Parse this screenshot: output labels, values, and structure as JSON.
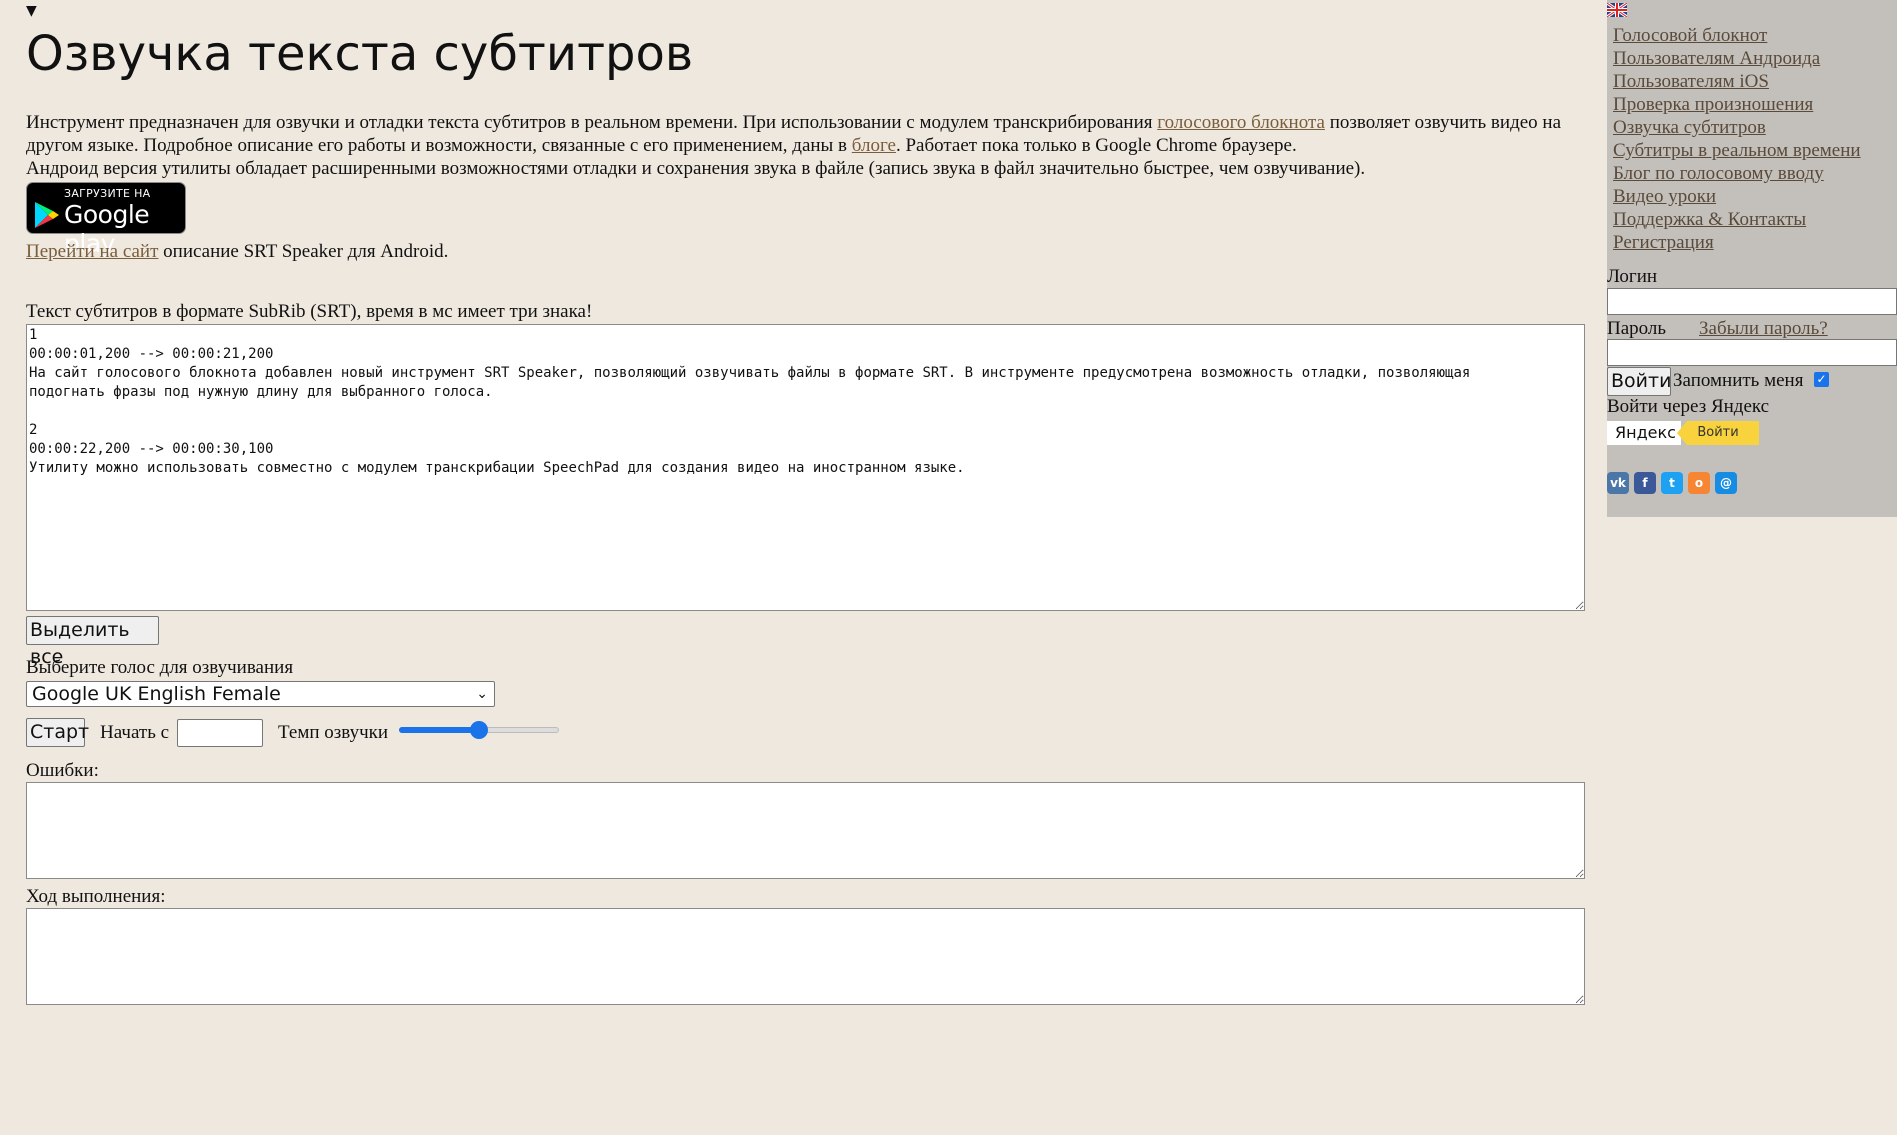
{
  "page": {
    "collapse_marker": "▼",
    "title": "Озвучка текста субтитров"
  },
  "intro": {
    "text1": "Инструмент предназначен для озвучки и отладки текста субтитров в реальном времени. При использовании с модулем транскрибирования ",
    "link1": "голосового блокнота",
    "text2": " позволяет озвучить видео на другом языке. Подробное описание его работы и возможности, связанные с его применением, даны в ",
    "link2": "блоге",
    "text3": ". Работает пока только в Google Chrome браузере.",
    "line2": "Андроид версия утилиты обладает расширенными возможностями отладки и сохранения звука в файле (запись звука в файл значительно быстрее, чем озвучивание)."
  },
  "google_play": {
    "small": "ЗАГРУЗИТЕ НА",
    "big": "Google play"
  },
  "site_link": {
    "link": "Перейти на сайт",
    "text": " описание SRT Speaker для Android."
  },
  "srt": {
    "label": "Текст субтитров в формате SubRib (SRT), время в мс имеет три знака!",
    "value": "1\n00:00:01,200 --> 00:00:21,200\nНа сайт голосового блокнота добавлен новый инструмент SRT Speaker, позволяющий озвучивать файлы в формате SRT. В инструменте предусмотрена возможность отладки, позволяющая\nподогнать фразы под нужную длину для выбранного голоса.\n\n2\n00:00:22,200 --> 00:00:30,100\nУтилиту можно использовать совместно с модулем транскрибации SpeechPad для создания видео на иностранном языке.",
    "select_all": "Выделить все"
  },
  "voice": {
    "label": "Выберите голос для озвучивания",
    "selected": "Google UK English Female"
  },
  "controls": {
    "start": "Старт",
    "start_from_label": "Начать с",
    "start_from_value": "",
    "tempo_label": "Темп озвучки",
    "tempo_level": 0.5
  },
  "errors": {
    "label": "Ошибки:",
    "value": ""
  },
  "progress": {
    "label": "Ход выполнения:",
    "value": ""
  },
  "sidebar": {
    "nav": [
      "Голосовой блокнот",
      "Пользователям Андроида",
      "Пользователям iOS",
      "Проверка произношения",
      "Озвучка субтитров",
      "Субтитры в реальном времени",
      "Блог по голосовому вводу",
      "Видео уроки",
      "Поддержка & Контакты",
      "Регистрация"
    ],
    "login_label": "Логин",
    "password_label": "Пароль",
    "forgot": "Забыли пароль?",
    "enter": "Войти",
    "remember": "Запомнить меня",
    "yandex_label": "Войти через Яндекс",
    "yandex_logo": "Яндекс",
    "yandex_button": "Войти"
  },
  "colors": {
    "background": "#efe8df",
    "sidebar": "#c3c0bc",
    "link": "#7a5d3a",
    "accent": "#1a73e8"
  }
}
